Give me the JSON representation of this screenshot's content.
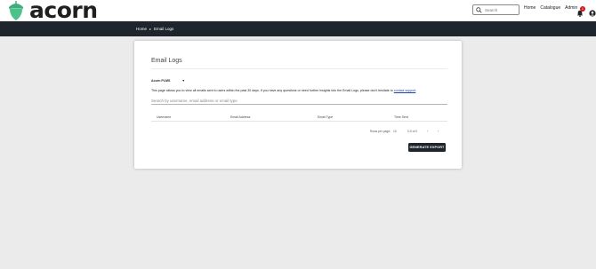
{
  "app": {
    "logo_text": "acorn",
    "brand_color": "#3fae7c"
  },
  "header": {
    "search_placeholder": "Search",
    "nav": [
      "Home",
      "Catalogue",
      "Admin"
    ],
    "notification_count": "1",
    "icons": [
      "bell-icon",
      "user-icon"
    ]
  },
  "breadcrumb": {
    "home": "Home",
    "separator": "▸",
    "current": "Email Logs"
  },
  "page": {
    "title": "Email Logs",
    "tenant_select": "Acorn PLMS",
    "info_text": "This page allows you to view all emails sent to users within the past 30 days. If you have any questions or need further insights into the Email Logs, please don't hesitate to",
    "info_link": "contact support",
    "info_end": ".",
    "search_placeholder": "Search by username, email address or email type"
  },
  "table": {
    "columns": [
      "Username",
      "Email Address",
      "Email Type",
      "Time Sent"
    ],
    "rows": []
  },
  "pagination": {
    "rows_per_page_label": "Rows per page:",
    "rows_per_page": "10",
    "range": "0-0 of 0",
    "prev": "‹",
    "next": "›"
  },
  "actions": {
    "export_label": "GENERATE EXPORT"
  },
  "colors": {
    "dark_bar": "#1e252c",
    "link": "#1a3fb0",
    "badge": "#d0191d"
  }
}
